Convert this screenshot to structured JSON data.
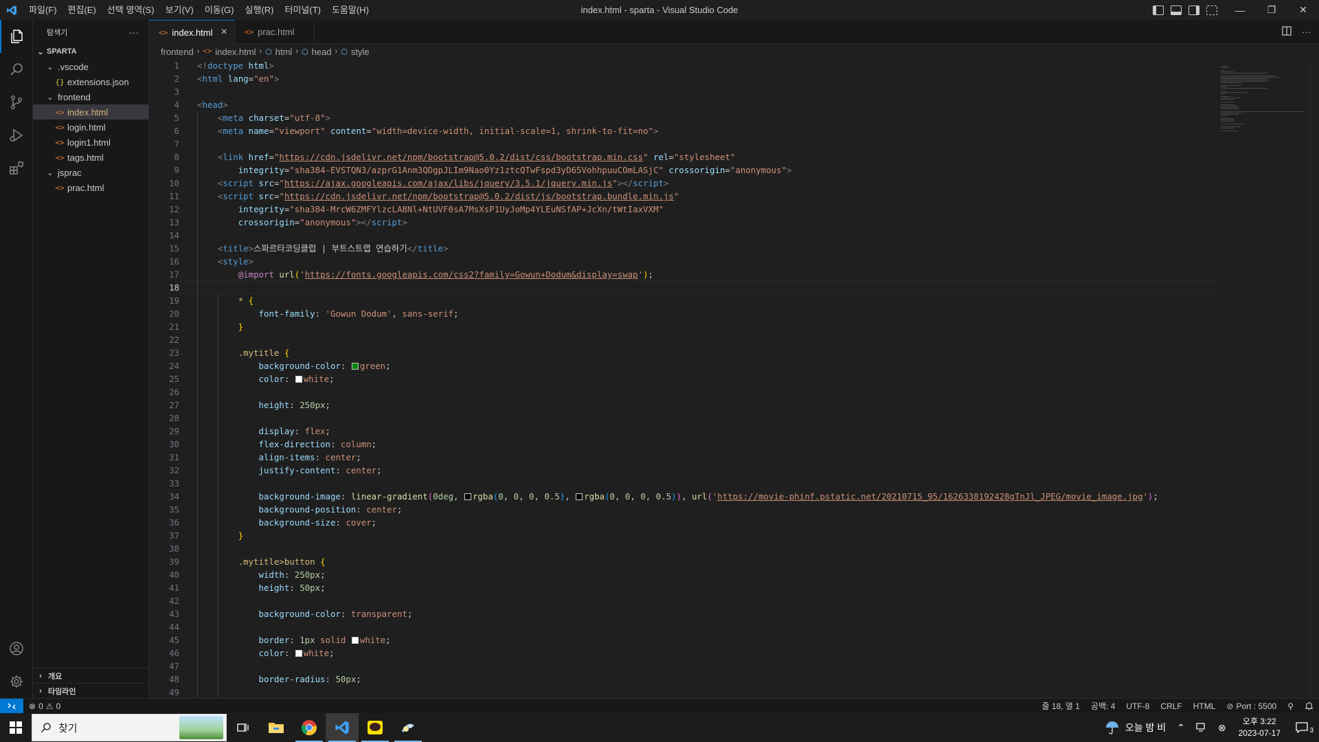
{
  "window": {
    "title": "index.html - sparta - Visual Studio Code"
  },
  "menu": [
    "파일(F)",
    "편집(E)",
    "선택 영역(S)",
    "보기(V)",
    "이동(G)",
    "실행(R)",
    "터미널(T)",
    "도움말(H)"
  ],
  "sidebar": {
    "title": "탐색기",
    "more": "···",
    "root": "SPARTA",
    "tree": [
      {
        "label": ".vscode",
        "kind": "folder",
        "depth": 1
      },
      {
        "label": "extensions.json",
        "kind": "json",
        "depth": 2
      },
      {
        "label": "frontend",
        "kind": "folder",
        "depth": 1
      },
      {
        "label": "index.html",
        "kind": "html",
        "depth": 2,
        "selected": true
      },
      {
        "label": "login.html",
        "kind": "html",
        "depth": 2
      },
      {
        "label": "login1.html",
        "kind": "html",
        "depth": 2
      },
      {
        "label": "tags.html",
        "kind": "html",
        "depth": 2
      },
      {
        "label": "jsprac",
        "kind": "folder",
        "depth": 1
      },
      {
        "label": "prac.html",
        "kind": "html",
        "depth": 2
      }
    ],
    "outline": "개요",
    "timeline": "타임라인"
  },
  "tabs": [
    {
      "label": "index.html",
      "active": true,
      "close": "×"
    },
    {
      "label": "prac.html",
      "active": false
    }
  ],
  "breadcrumb": [
    "frontend",
    "index.html",
    "html",
    "head",
    "style"
  ],
  "editor": {
    "current_line": 18
  },
  "code_lines": [
    [
      [
        "tag",
        "<!"
      ],
      [
        "tn",
        "doctype"
      ],
      [
        "pn",
        " "
      ],
      [
        "an",
        "html"
      ],
      [
        "tag",
        ">"
      ]
    ],
    [
      [
        "tag",
        "<"
      ],
      [
        "tn",
        "html"
      ],
      [
        "pn",
        " "
      ],
      [
        "an",
        "lang"
      ],
      [
        "pn",
        "="
      ],
      [
        "av",
        "\"en\""
      ],
      [
        "tag",
        ">"
      ]
    ],
    [],
    [
      [
        "tag",
        "<"
      ],
      [
        "tn",
        "head"
      ],
      [
        "tag",
        ">"
      ]
    ],
    [
      [
        "pn",
        "    "
      ],
      [
        "tag",
        "<"
      ],
      [
        "tn",
        "meta"
      ],
      [
        "pn",
        " "
      ],
      [
        "an",
        "charset"
      ],
      [
        "pn",
        "="
      ],
      [
        "av",
        "\"utf-8\""
      ],
      [
        "tag",
        ">"
      ]
    ],
    [
      [
        "pn",
        "    "
      ],
      [
        "tag",
        "<"
      ],
      [
        "tn",
        "meta"
      ],
      [
        "pn",
        " "
      ],
      [
        "an",
        "name"
      ],
      [
        "pn",
        "="
      ],
      [
        "av",
        "\"viewport\""
      ],
      [
        "pn",
        " "
      ],
      [
        "an",
        "content"
      ],
      [
        "pn",
        "="
      ],
      [
        "av",
        "\"width=device-width, initial-scale=1, shrink-to-fit=no\""
      ],
      [
        "tag",
        ">"
      ]
    ],
    [],
    [
      [
        "pn",
        "    "
      ],
      [
        "tag",
        "<"
      ],
      [
        "tn",
        "link"
      ],
      [
        "pn",
        " "
      ],
      [
        "an",
        "href"
      ],
      [
        "pn",
        "="
      ],
      [
        "av",
        "\""
      ],
      [
        "url",
        "https://cdn.jsdelivr.net/npm/bootstrap@5.0.2/dist/css/bootstrap.min.css"
      ],
      [
        "av",
        "\""
      ],
      [
        "pn",
        " "
      ],
      [
        "an",
        "rel"
      ],
      [
        "pn",
        "="
      ],
      [
        "av",
        "\"stylesheet\""
      ]
    ],
    [
      [
        "pn",
        "        "
      ],
      [
        "an",
        "integrity"
      ],
      [
        "pn",
        "="
      ],
      [
        "av",
        "\"sha384-EVSTQN3/azprG1Anm3QDgpJLIm9Nao0Yz1ztcQTwFspd3yD65VohhpuuCOmLASjC\""
      ],
      [
        "pn",
        " "
      ],
      [
        "an",
        "crossorigin"
      ],
      [
        "pn",
        "="
      ],
      [
        "av",
        "\"anonymous\""
      ],
      [
        "tag",
        ">"
      ]
    ],
    [
      [
        "pn",
        "    "
      ],
      [
        "tag",
        "<"
      ],
      [
        "tn",
        "script"
      ],
      [
        "pn",
        " "
      ],
      [
        "an",
        "src"
      ],
      [
        "pn",
        "="
      ],
      [
        "av",
        "\""
      ],
      [
        "url",
        "https://ajax.googleapis.com/ajax/libs/jquery/3.5.1/jquery.min.js"
      ],
      [
        "av",
        "\""
      ],
      [
        "tag",
        "></"
      ],
      [
        "tn",
        "script"
      ],
      [
        "tag",
        ">"
      ]
    ],
    [
      [
        "pn",
        "    "
      ],
      [
        "tag",
        "<"
      ],
      [
        "tn",
        "script"
      ],
      [
        "pn",
        " "
      ],
      [
        "an",
        "src"
      ],
      [
        "pn",
        "="
      ],
      [
        "av",
        "\""
      ],
      [
        "url",
        "https://cdn.jsdelivr.net/npm/bootstrap@5.0.2/dist/js/bootstrap.bundle.min.js"
      ],
      [
        "av",
        "\""
      ]
    ],
    [
      [
        "pn",
        "        "
      ],
      [
        "an",
        "integrity"
      ],
      [
        "pn",
        "="
      ],
      [
        "av",
        "\"sha384-MrcW6ZMFYlzcLA8Nl+NtUVF0sA7MsXsP1UyJoMp4YLEuNSfAP+JcXn/tWtIaxVXM\""
      ]
    ],
    [
      [
        "pn",
        "        "
      ],
      [
        "an",
        "crossorigin"
      ],
      [
        "pn",
        "="
      ],
      [
        "av",
        "\"anonymous\""
      ],
      [
        "tag",
        "></"
      ],
      [
        "tn",
        "script"
      ],
      [
        "tag",
        ">"
      ]
    ],
    [],
    [
      [
        "pn",
        "    "
      ],
      [
        "tag",
        "<"
      ],
      [
        "tn",
        "title"
      ],
      [
        "tag",
        ">"
      ],
      [
        "pn",
        "스파르타코딩클럽 | 부트스트랩 연습하기"
      ],
      [
        "tag",
        "</"
      ],
      [
        "tn",
        "title"
      ],
      [
        "tag",
        ">"
      ]
    ],
    [
      [
        "pn",
        "    "
      ],
      [
        "tag",
        "<"
      ],
      [
        "tn",
        "style"
      ],
      [
        "tag",
        ">"
      ]
    ],
    [
      [
        "pn",
        "        "
      ],
      [
        "at",
        "@import"
      ],
      [
        "pn",
        " "
      ],
      [
        "fn",
        "url"
      ],
      [
        "br",
        "("
      ],
      [
        "av",
        "'"
      ],
      [
        "url",
        "https://fonts.googleapis.com/css2?family=Gowun+Dodum&display=swap"
      ],
      [
        "av",
        "'"
      ],
      [
        "br",
        ")"
      ],
      [
        "pn",
        ";"
      ]
    ],
    [],
    [
      [
        "pn",
        "        "
      ],
      [
        "sel",
        "*"
      ],
      [
        "pn",
        " "
      ],
      [
        "br",
        "{"
      ]
    ],
    [
      [
        "pn",
        "            "
      ],
      [
        "pr",
        "font-family"
      ],
      [
        "pn",
        ": "
      ],
      [
        "vl",
        "'Gowun Dodum'"
      ],
      [
        "pn",
        ", "
      ],
      [
        "vl",
        "sans-serif"
      ],
      [
        "pn",
        ";"
      ]
    ],
    [
      [
        "pn",
        "        "
      ],
      [
        "br",
        "}"
      ]
    ],
    [],
    [
      [
        "pn",
        "        "
      ],
      [
        "sel",
        ".mytitle"
      ],
      [
        "pn",
        " "
      ],
      [
        "br",
        "{"
      ]
    ],
    [
      [
        "pn",
        "            "
      ],
      [
        "pr",
        "background-color"
      ],
      [
        "pn",
        ": "
      ],
      [
        "sw",
        "#008000"
      ],
      [
        "vl",
        "green"
      ],
      [
        "pn",
        ";"
      ]
    ],
    [
      [
        "pn",
        "            "
      ],
      [
        "pr",
        "color"
      ],
      [
        "pn",
        ": "
      ],
      [
        "sw",
        "#ffffff"
      ],
      [
        "vl",
        "white"
      ],
      [
        "pn",
        ";"
      ]
    ],
    [],
    [
      [
        "pn",
        "            "
      ],
      [
        "pr",
        "height"
      ],
      [
        "pn",
        ": "
      ],
      [
        "nm",
        "250px"
      ],
      [
        "pn",
        ";"
      ]
    ],
    [],
    [
      [
        "pn",
        "            "
      ],
      [
        "pr",
        "display"
      ],
      [
        "pn",
        ": "
      ],
      [
        "vl",
        "flex"
      ],
      [
        "pn",
        ";"
      ]
    ],
    [
      [
        "pn",
        "            "
      ],
      [
        "pr",
        "flex-direction"
      ],
      [
        "pn",
        ": "
      ],
      [
        "vl",
        "column"
      ],
      [
        "pn",
        ";"
      ]
    ],
    [
      [
        "pn",
        "            "
      ],
      [
        "pr",
        "align-items"
      ],
      [
        "pn",
        ": "
      ],
      [
        "vl",
        "center"
      ],
      [
        "pn",
        ";"
      ]
    ],
    [
      [
        "pn",
        "            "
      ],
      [
        "pr",
        "justify-content"
      ],
      [
        "pn",
        ": "
      ],
      [
        "vl",
        "center"
      ],
      [
        "pn",
        ";"
      ]
    ],
    [],
    [
      [
        "pn",
        "            "
      ],
      [
        "pr",
        "background-image"
      ],
      [
        "pn",
        ": "
      ],
      [
        "fn",
        "linear-gradient"
      ],
      [
        "br2",
        "("
      ],
      [
        "nm",
        "0deg"
      ],
      [
        "pn",
        ", "
      ],
      [
        "sw",
        "#000000"
      ],
      [
        "fn",
        "rgba"
      ],
      [
        "br3",
        "("
      ],
      [
        "nm",
        "0"
      ],
      [
        "pn",
        ", "
      ],
      [
        "nm",
        "0"
      ],
      [
        "pn",
        ", "
      ],
      [
        "nm",
        "0"
      ],
      [
        "pn",
        ", "
      ],
      [
        "nm",
        "0.5"
      ],
      [
        "br3",
        ")"
      ],
      [
        "pn",
        ", "
      ],
      [
        "sw",
        "#000000"
      ],
      [
        "fn",
        "rgba"
      ],
      [
        "br3",
        "("
      ],
      [
        "nm",
        "0"
      ],
      [
        "pn",
        ", "
      ],
      [
        "nm",
        "0"
      ],
      [
        "pn",
        ", "
      ],
      [
        "nm",
        "0"
      ],
      [
        "pn",
        ", "
      ],
      [
        "nm",
        "0.5"
      ],
      [
        "br3",
        ")"
      ],
      [
        "br2",
        ")"
      ],
      [
        "pn",
        ", "
      ],
      [
        "fn",
        "url"
      ],
      [
        "br2",
        "("
      ],
      [
        "av",
        "'"
      ],
      [
        "url",
        "https://movie-phinf.pstatic.net/20210715_95/1626338192428gTnJl_JPEG/movie_image.jpg"
      ],
      [
        "av",
        "'"
      ],
      [
        "br2",
        ")"
      ],
      [
        "pn",
        ";"
      ]
    ],
    [
      [
        "pn",
        "            "
      ],
      [
        "pr",
        "background-position"
      ],
      [
        "pn",
        ": "
      ],
      [
        "vl",
        "center"
      ],
      [
        "pn",
        ";"
      ]
    ],
    [
      [
        "pn",
        "            "
      ],
      [
        "pr",
        "background-size"
      ],
      [
        "pn",
        ": "
      ],
      [
        "vl",
        "cover"
      ],
      [
        "pn",
        ";"
      ]
    ],
    [
      [
        "pn",
        "        "
      ],
      [
        "br",
        "}"
      ]
    ],
    [],
    [
      [
        "pn",
        "        "
      ],
      [
        "sel",
        ".mytitle>button"
      ],
      [
        "pn",
        " "
      ],
      [
        "br",
        "{"
      ]
    ],
    [
      [
        "pn",
        "            "
      ],
      [
        "pr",
        "width"
      ],
      [
        "pn",
        ": "
      ],
      [
        "nm",
        "250px"
      ],
      [
        "pn",
        ";"
      ]
    ],
    [
      [
        "pn",
        "            "
      ],
      [
        "pr",
        "height"
      ],
      [
        "pn",
        ": "
      ],
      [
        "nm",
        "50px"
      ],
      [
        "pn",
        ";"
      ]
    ],
    [],
    [
      [
        "pn",
        "            "
      ],
      [
        "pr",
        "background-color"
      ],
      [
        "pn",
        ": "
      ],
      [
        "vl",
        "transparent"
      ],
      [
        "pn",
        ";"
      ]
    ],
    [],
    [
      [
        "pn",
        "            "
      ],
      [
        "pr",
        "border"
      ],
      [
        "pn",
        ": "
      ],
      [
        "nm",
        "1px"
      ],
      [
        "pn",
        " "
      ],
      [
        "vl",
        "solid"
      ],
      [
        "pn",
        " "
      ],
      [
        "sw",
        "#ffffff"
      ],
      [
        "vl",
        "white"
      ],
      [
        "pn",
        ";"
      ]
    ],
    [
      [
        "pn",
        "            "
      ],
      [
        "pr",
        "color"
      ],
      [
        "pn",
        ": "
      ],
      [
        "sw",
        "#ffffff"
      ],
      [
        "vl",
        "white"
      ],
      [
        "pn",
        ";"
      ]
    ],
    [],
    [
      [
        "pn",
        "            "
      ],
      [
        "pr",
        "border-radius"
      ],
      [
        "pn",
        ": "
      ],
      [
        "nm",
        "50px"
      ],
      [
        "pn",
        ";"
      ]
    ],
    []
  ],
  "status": {
    "problems": "0",
    "warnings": "0",
    "position": "줄 18, 열 1",
    "spaces": "공백: 4",
    "encoding": "UTF-8",
    "eol": "CRLF",
    "language": "HTML",
    "port": "Port : 5500"
  },
  "taskbar": {
    "search_placeholder": "찾기",
    "weather": "오늘 밤 비",
    "time": "오후 3:22",
    "date": "2023-07-17",
    "notif_count": "3"
  },
  "colors": {
    "accent": "#0078d4",
    "statusbar": "#181818",
    "editor_bg": "#1f1f1f"
  }
}
